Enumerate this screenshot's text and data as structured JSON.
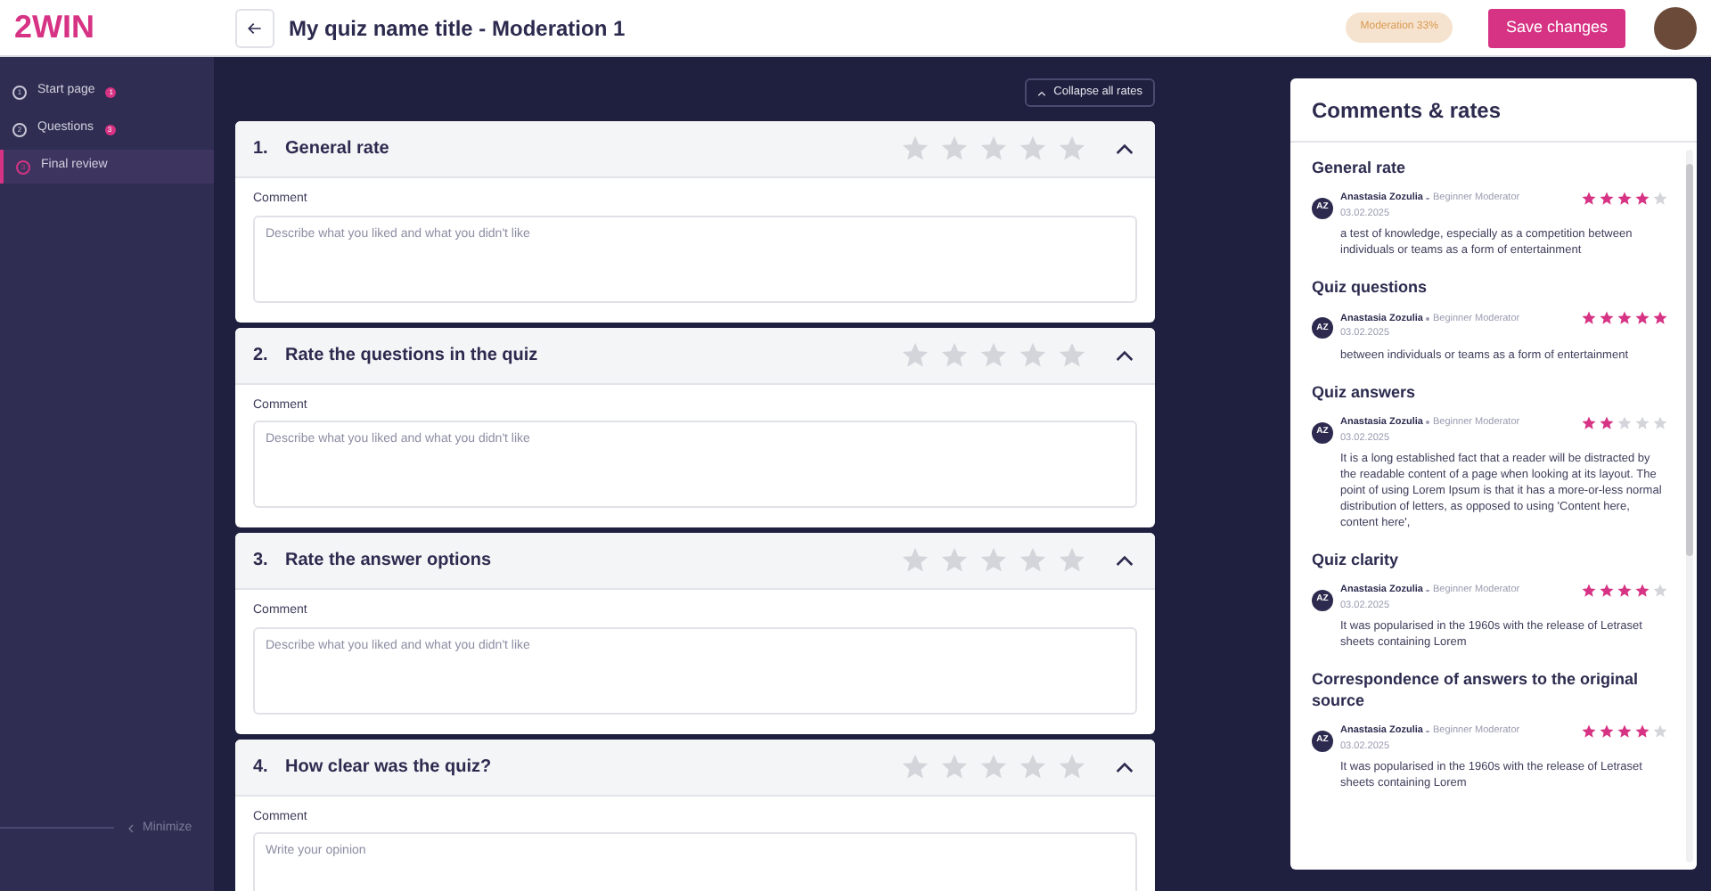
{
  "header": {
    "logo": "2WIN",
    "title": "My quiz name title - Moderation 1",
    "status": "Moderation 33%",
    "save_button": "Save changes"
  },
  "sidebar": {
    "items": [
      {
        "step": "1",
        "label": "Start page",
        "badge": "1",
        "selected": false
      },
      {
        "step": "2",
        "label": "Questions",
        "badge": "3",
        "selected": false
      },
      {
        "step": "3",
        "label": "Final review",
        "selected": true
      }
    ],
    "minimize": "Minimize"
  },
  "collapse_button": "Collapse all rates",
  "rates": [
    {
      "number": "1.",
      "title": "General rate",
      "stars": 0,
      "expanded": true,
      "comment_label": "Comment",
      "placeholder": "Describe what you liked and what you didn't like"
    },
    {
      "number": "2.",
      "title": "Rate the questions in the quiz",
      "stars": 0,
      "expanded": true,
      "comment_label": "Comment",
      "placeholder": "Describe what you liked and what you didn't like"
    },
    {
      "number": "3.",
      "title": "Rate the answer options",
      "stars": 0,
      "expanded": true,
      "comment_label": "Comment",
      "placeholder": "Describe what you liked and what you didn't like"
    },
    {
      "number": "4.",
      "title": "How clear was the quiz?",
      "stars": 0,
      "expanded": true,
      "comment_label": "Comment",
      "placeholder": "Write your opinion"
    }
  ],
  "comments_panel": {
    "title": "Comments & rates",
    "sections": [
      {
        "title": "General rate",
        "initials": "AZ",
        "author": "Anastasia Zozulia",
        "role": "Beginner Moderator",
        "date": "03.02.2025",
        "stars": 4,
        "text": "a test of knowledge, especially as a competition between individuals or teams as a form of entertainment"
      },
      {
        "title": "Quiz questions",
        "initials": "AZ",
        "author": "Anastasia Zozulia",
        "role": "Beginner Moderator",
        "date": "03.02.2025",
        "stars": 5,
        "text": "between individuals or teams as a form of entertainment"
      },
      {
        "title": "Quiz answers",
        "initials": "AZ",
        "author": "Anastasia Zozulia",
        "role": "Beginner Moderator",
        "date": "03.02.2025",
        "stars": 2,
        "text": "It is a long established fact that a reader will be distracted by the readable content of a page when looking at its layout. The point of using Lorem Ipsum is that it has a more-or-less normal distribution of letters, as opposed to using 'Content here, content here',"
      },
      {
        "title": "Quiz clarity",
        "initials": "AZ",
        "author": "Anastasia Zozulia",
        "role": "Beginner Moderator",
        "date": "03.02.2025",
        "stars": 4,
        "text": "It was popularised in the 1960s with the release of Letraset sheets containing Lorem"
      },
      {
        "title": "Correspondence of answers to the original source",
        "initials": "AZ",
        "author": "Anastasia Zozulia",
        "role": "Beginner Moderator",
        "date": "03.02.2025",
        "stars": 4,
        "text": "It was popularised in the 1960s with the release of Letraset sheets containing Lorem"
      }
    ]
  }
}
